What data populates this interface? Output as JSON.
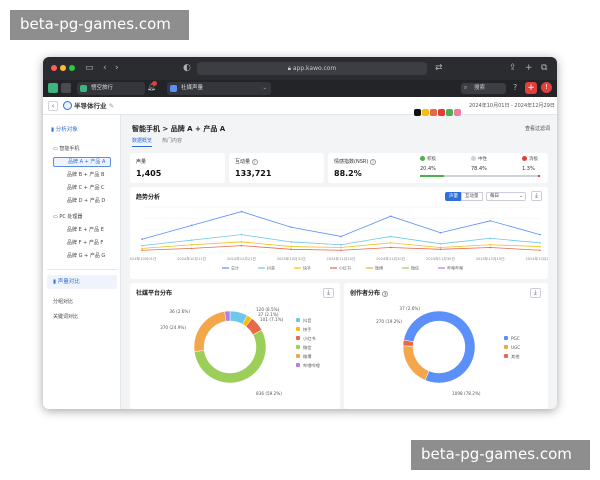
{
  "watermarks": {
    "top": "beta-pg-games.com",
    "bottom": "beta-pg-games.com"
  },
  "browser": {
    "url": "app.kawo.com",
    "tabs": [
      {
        "label": "悟空旅行"
      },
      {
        "label": "社媒声量"
      }
    ],
    "search_placeholder": "搜索",
    "colors": {
      "titlebar": "#2b2c30",
      "tab_accent": "#3fb37f",
      "plus": "#e0403a"
    }
  },
  "app": {
    "title": "半导体行业",
    "date_range": "2024年10月01日 - 2024年12月29日"
  },
  "sidebar": {
    "section1": "分析对象",
    "group1": {
      "label": "智能手机",
      "items": [
        "品牌 A + 产品 A",
        "品牌 B + 产品 B",
        "品牌 C + 产品 C",
        "品牌 D + 产品 D"
      ]
    },
    "group2": {
      "label": "PC 处理器",
      "items": [
        "品牌 E + 产品 E",
        "品牌 F + 产品 F",
        "品牌 G + 产品 G"
      ]
    },
    "section2": "声量对比",
    "links": [
      "分组对比",
      "关键词对比"
    ]
  },
  "main": {
    "breadcrumb": "智能手机 > 品牌 A + 产品 A",
    "back_label": "查看过滤词",
    "subtabs": [
      "数据概览",
      "热门内容"
    ],
    "kpis": [
      {
        "label": "声量",
        "value": "1,405"
      },
      {
        "label": "互动量",
        "value": "133,721"
      },
      {
        "label": "情感指数(NSR)",
        "value": "88.2%"
      }
    ],
    "sentiment": {
      "labels": [
        "积极",
        "中性",
        "消极"
      ],
      "values": [
        "20.4%",
        "78.4%",
        "1.3%"
      ],
      "colors": [
        "#4caf50",
        "#cfd3d8",
        "#e0403a"
      ]
    },
    "trend": {
      "title": "趋势分析",
      "toggle_on": "声量",
      "toggle_off": "互动量",
      "select": "每日",
      "x_ticks": [
        "2024年10月01日",
        "2024年10月11日",
        "2024年10月21日",
        "2024年10月31日",
        "2024年11月10日",
        "2024年11月20日",
        "2024年11月30日",
        "2024年12月10日",
        "2024年12月20日"
      ],
      "legend": [
        {
          "name": "总计",
          "color": "#5b8ff9"
        },
        {
          "name": "抖音",
          "color": "#6dc8ec"
        },
        {
          "name": "快手",
          "color": "#f6bd16"
        },
        {
          "name": "小红书",
          "color": "#e8684a"
        },
        {
          "name": "微博",
          "color": "#f4a64b"
        },
        {
          "name": "微信",
          "color": "#9ccf5a"
        },
        {
          "name": "哔哩哔哩",
          "color": "#b37feb"
        }
      ]
    },
    "platform": {
      "title": "社媒平台分布",
      "labels_left": [
        "36 (2.6%)",
        "370 (24.9%)"
      ],
      "labels_right": [
        "120 (8.5%)",
        "37 (2.1%)",
        "101 (7.1%)"
      ],
      "label_bottom": "836 (59.2%)",
      "legend": [
        {
          "name": "抖音",
          "color": "#6dc8ec"
        },
        {
          "name": "快手",
          "color": "#f6bd16"
        },
        {
          "name": "小红书",
          "color": "#e8684a"
        },
        {
          "name": "微信",
          "color": "#9ccf5a"
        },
        {
          "name": "微博",
          "color": "#f4a64b"
        },
        {
          "name": "哔哩哔哩",
          "color": "#b37feb"
        }
      ]
    },
    "creator": {
      "title": "创作者分布",
      "label_top": "37 (2.6%)",
      "label_left": "270 (19.2%)",
      "label_bottom": "1098 (78.2%)",
      "legend": [
        {
          "name": "PGC",
          "color": "#5b8ff9"
        },
        {
          "name": "UGC",
          "color": "#f4a64b"
        },
        {
          "name": "其他",
          "color": "#e8684a"
        }
      ]
    }
  },
  "chart_data": [
    {
      "type": "line",
      "title": "趋势分析",
      "x": [
        "2024年10月01日",
        "2024年10月11日",
        "2024年10月21日",
        "2024年10月31日",
        "2024年11月10日",
        "2024年11月20日",
        "2024年11月30日",
        "2024年12月10日",
        "2024年12月20日"
      ],
      "series": [
        {
          "name": "总计",
          "values": [
            15,
            30,
            45,
            28,
            18,
            40,
            22,
            35,
            20
          ]
        },
        {
          "name": "抖音",
          "values": [
            8,
            14,
            20,
            12,
            9,
            18,
            10,
            16,
            11
          ]
        },
        {
          "name": "快手",
          "values": [
            5,
            9,
            12,
            7,
            6,
            11,
            6,
            9,
            7
          ]
        },
        {
          "name": "小红书",
          "values": [
            3,
            5,
            8,
            4,
            3,
            6,
            4,
            6,
            3
          ]
        }
      ],
      "legend_position": "bottom"
    },
    {
      "type": "pie",
      "title": "社媒平台分布",
      "categories": [
        "抖音",
        "快手",
        "小红书",
        "微信",
        "微博",
        "哔哩哔哩"
      ],
      "values": [
        120,
        37,
        101,
        836,
        370,
        36
      ],
      "labels": [
        "120 (8.5%)",
        "37 (2.1%)",
        "101 (7.1%)",
        "836 (59.2%)",
        "370 (24.9%)",
        "36 (2.6%)"
      ]
    },
    {
      "type": "pie",
      "title": "创作者分布",
      "categories": [
        "PGC",
        "UGC",
        "其他"
      ],
      "values": [
        1098,
        270,
        37
      ],
      "labels": [
        "1098 (78.2%)",
        "270 (19.2%)",
        "37 (2.6%)"
      ]
    }
  ]
}
